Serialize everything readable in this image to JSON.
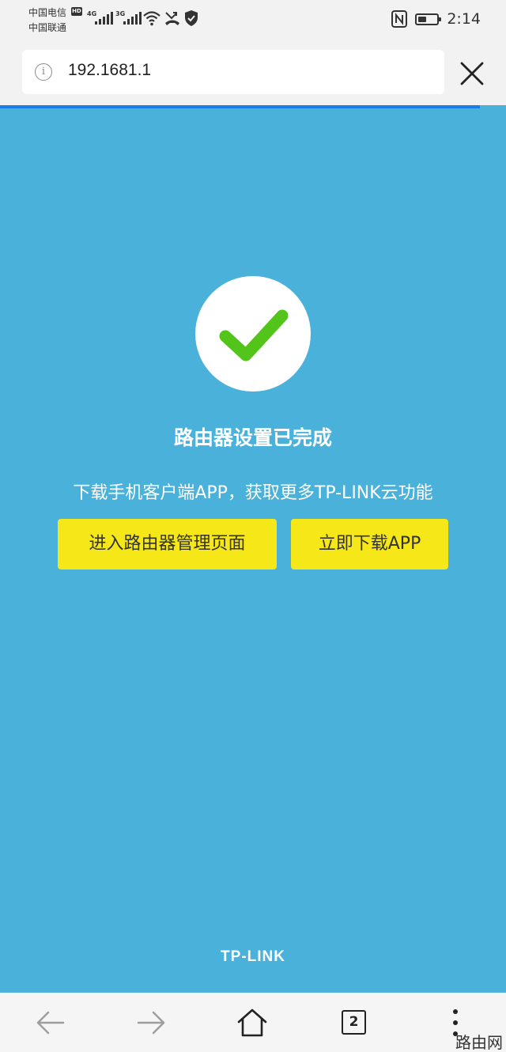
{
  "status_bar": {
    "carrier_1": "中国电信",
    "carrier_2": "中国联通",
    "hd": "HD",
    "network_1": "4G",
    "network_2": "3G",
    "battery_level": 0.45,
    "time": "2:14"
  },
  "address_bar": {
    "url": "192.1681.1",
    "info_icon": "info-icon",
    "close_icon": "close-icon"
  },
  "page": {
    "title": "路由器设置已完成",
    "subtitle": "下载手机客户端APP，获取更多TP-LINK云功能",
    "manage_button": "进入路由器管理页面",
    "download_button": "立即下载APP",
    "brand": "TP-LINK",
    "accent_color": "#f6e719",
    "background_color": "#4ab2da",
    "check_color": "#52c41a"
  },
  "bottom_nav": {
    "tab_count": "2"
  },
  "watermark": "路由网"
}
